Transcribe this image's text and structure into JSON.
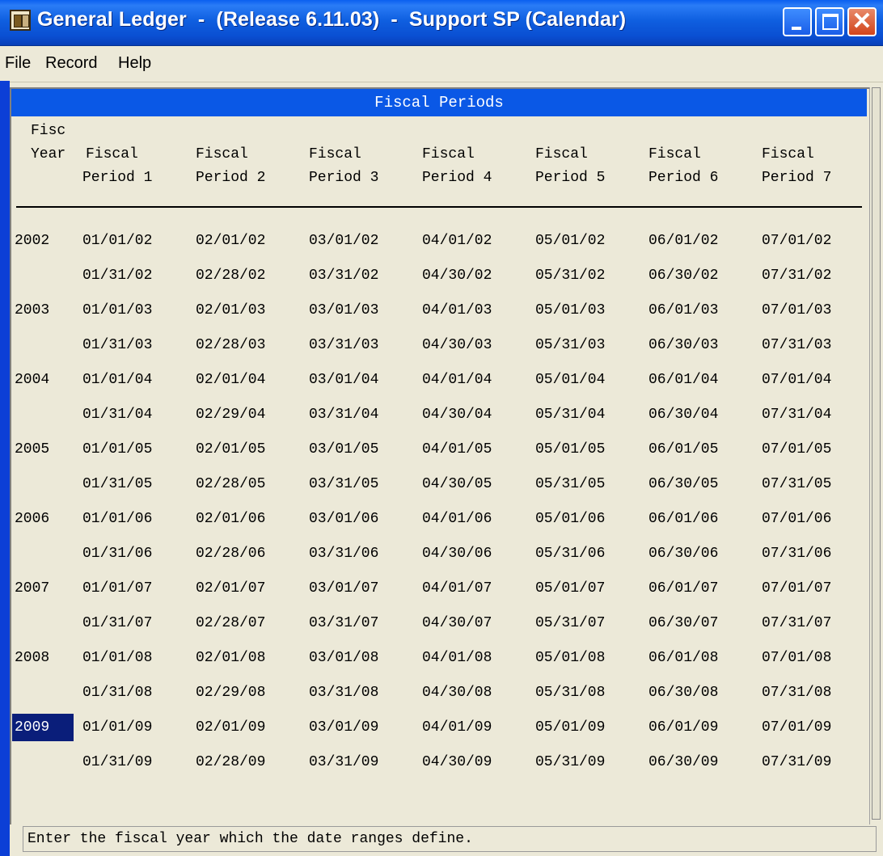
{
  "window": {
    "title": "General Ledger  -  (Release 6.11.03)  -  Support SP (Calendar)",
    "colors": {
      "titlebar": "#0a5ff0",
      "selection": "#0a1e7a",
      "header": "#0a58e6"
    }
  },
  "menu": {
    "file": "File",
    "record": "Record",
    "help": "Help"
  },
  "panel": {
    "title": "Fiscal Periods",
    "year_header": [
      "Fisc",
      "Year"
    ],
    "period_headers": [
      [
        "Fiscal",
        "Period 1"
      ],
      [
        "Fiscal",
        "Period 2"
      ],
      [
        "Fiscal",
        "Period 3"
      ],
      [
        "Fiscal",
        "Period 4"
      ],
      [
        "Fiscal",
        "Period 5"
      ],
      [
        "Fiscal",
        "Period 6"
      ],
      [
        "Fiscal",
        "Period 7"
      ]
    ]
  },
  "years": [
    {
      "year": "2002",
      "starts": [
        "01/01/02",
        "02/01/02",
        "03/01/02",
        "04/01/02",
        "05/01/02",
        "06/01/02",
        "07/01/02"
      ],
      "ends": [
        "01/31/02",
        "02/28/02",
        "03/31/02",
        "04/30/02",
        "05/31/02",
        "06/30/02",
        "07/31/02"
      ]
    },
    {
      "year": "2003",
      "starts": [
        "01/01/03",
        "02/01/03",
        "03/01/03",
        "04/01/03",
        "05/01/03",
        "06/01/03",
        "07/01/03"
      ],
      "ends": [
        "01/31/03",
        "02/28/03",
        "03/31/03",
        "04/30/03",
        "05/31/03",
        "06/30/03",
        "07/31/03"
      ]
    },
    {
      "year": "2004",
      "starts": [
        "01/01/04",
        "02/01/04",
        "03/01/04",
        "04/01/04",
        "05/01/04",
        "06/01/04",
        "07/01/04"
      ],
      "ends": [
        "01/31/04",
        "02/29/04",
        "03/31/04",
        "04/30/04",
        "05/31/04",
        "06/30/04",
        "07/31/04"
      ]
    },
    {
      "year": "2005",
      "starts": [
        "01/01/05",
        "02/01/05",
        "03/01/05",
        "04/01/05",
        "05/01/05",
        "06/01/05",
        "07/01/05"
      ],
      "ends": [
        "01/31/05",
        "02/28/05",
        "03/31/05",
        "04/30/05",
        "05/31/05",
        "06/30/05",
        "07/31/05"
      ]
    },
    {
      "year": "2006",
      "starts": [
        "01/01/06",
        "02/01/06",
        "03/01/06",
        "04/01/06",
        "05/01/06",
        "06/01/06",
        "07/01/06"
      ],
      "ends": [
        "01/31/06",
        "02/28/06",
        "03/31/06",
        "04/30/06",
        "05/31/06",
        "06/30/06",
        "07/31/06"
      ]
    },
    {
      "year": "2007",
      "starts": [
        "01/01/07",
        "02/01/07",
        "03/01/07",
        "04/01/07",
        "05/01/07",
        "06/01/07",
        "07/01/07"
      ],
      "ends": [
        "01/31/07",
        "02/28/07",
        "03/31/07",
        "04/30/07",
        "05/31/07",
        "06/30/07",
        "07/31/07"
      ]
    },
    {
      "year": "2008",
      "starts": [
        "01/01/08",
        "02/01/08",
        "03/01/08",
        "04/01/08",
        "05/01/08",
        "06/01/08",
        "07/01/08"
      ],
      "ends": [
        "01/31/08",
        "02/29/08",
        "03/31/08",
        "04/30/08",
        "05/31/08",
        "06/30/08",
        "07/31/08"
      ]
    },
    {
      "year": "2009",
      "selected": true,
      "starts": [
        "01/01/09",
        "02/01/09",
        "03/01/09",
        "04/01/09",
        "05/01/09",
        "06/01/09",
        "07/01/09"
      ],
      "ends": [
        "01/31/09",
        "02/28/09",
        "03/31/09",
        "04/30/09",
        "05/31/09",
        "06/30/09",
        "07/31/09"
      ]
    }
  ],
  "status": {
    "message": "Enter the fiscal year which the date ranges define."
  }
}
